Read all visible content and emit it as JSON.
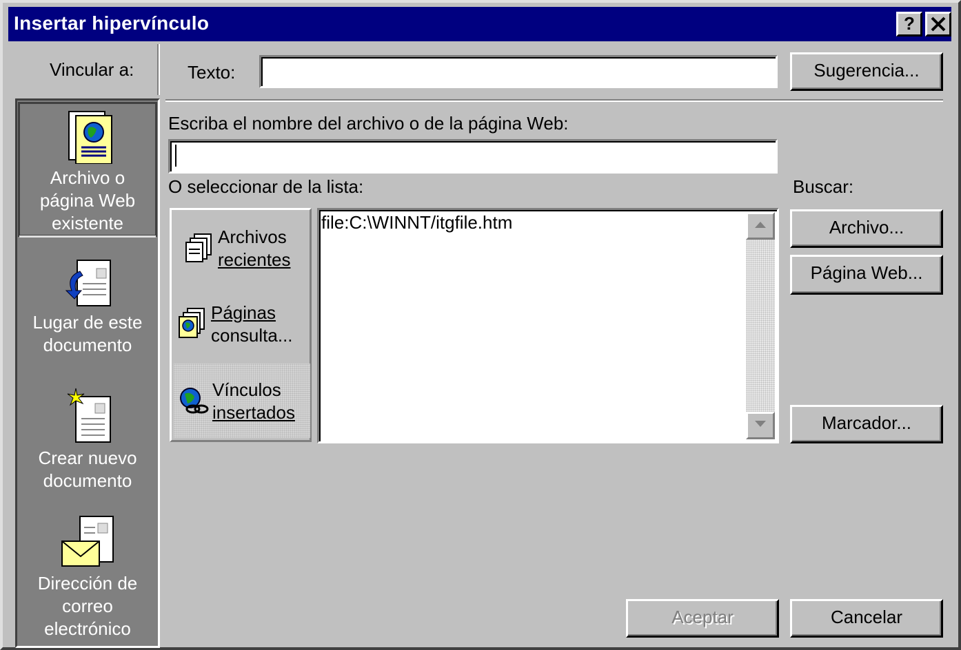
{
  "window": {
    "title": "Insertar hipervínculo",
    "help": "?",
    "close": "✕"
  },
  "link_to_label": "Vincular a:",
  "nav": {
    "existing_file": {
      "line1": "Archivo o",
      "line2": "página Web",
      "line3": "existente",
      "icon": "web-page-icon"
    },
    "place_in_doc": {
      "line1": "Lugar de este",
      "line2": "documento",
      "icon": "document-place-icon"
    },
    "new_doc": {
      "line1": "Crear nuevo",
      "line2": "documento",
      "icon": "new-document-icon"
    },
    "email": {
      "line1": "Dirección de",
      "line2": "correo",
      "line3": "electrónico",
      "icon": "email-icon"
    }
  },
  "text_label": "Texto:",
  "text_value": "",
  "suggestion_button": "Sugerencia...",
  "filename_label": "Escriba el nombre del archivo o de la página Web:",
  "filename_value": "",
  "or_select_label": "O seleccionar de la lista:",
  "search_label": "Buscar:",
  "list_categories": {
    "recent": {
      "line1": "Archivos",
      "line2": "recientes"
    },
    "browsed": {
      "line1": "Páginas",
      "line2": "consulta..."
    },
    "inserted": {
      "line1": "Vínculos",
      "line2": "insertados"
    }
  },
  "list_items": [
    "file:C:\\WINNT/itgfile.htm"
  ],
  "buttons": {
    "file": "Archivo...",
    "web_page": "Página Web...",
    "bookmark": "Marcador...",
    "ok": "Aceptar",
    "cancel": "Cancelar"
  }
}
